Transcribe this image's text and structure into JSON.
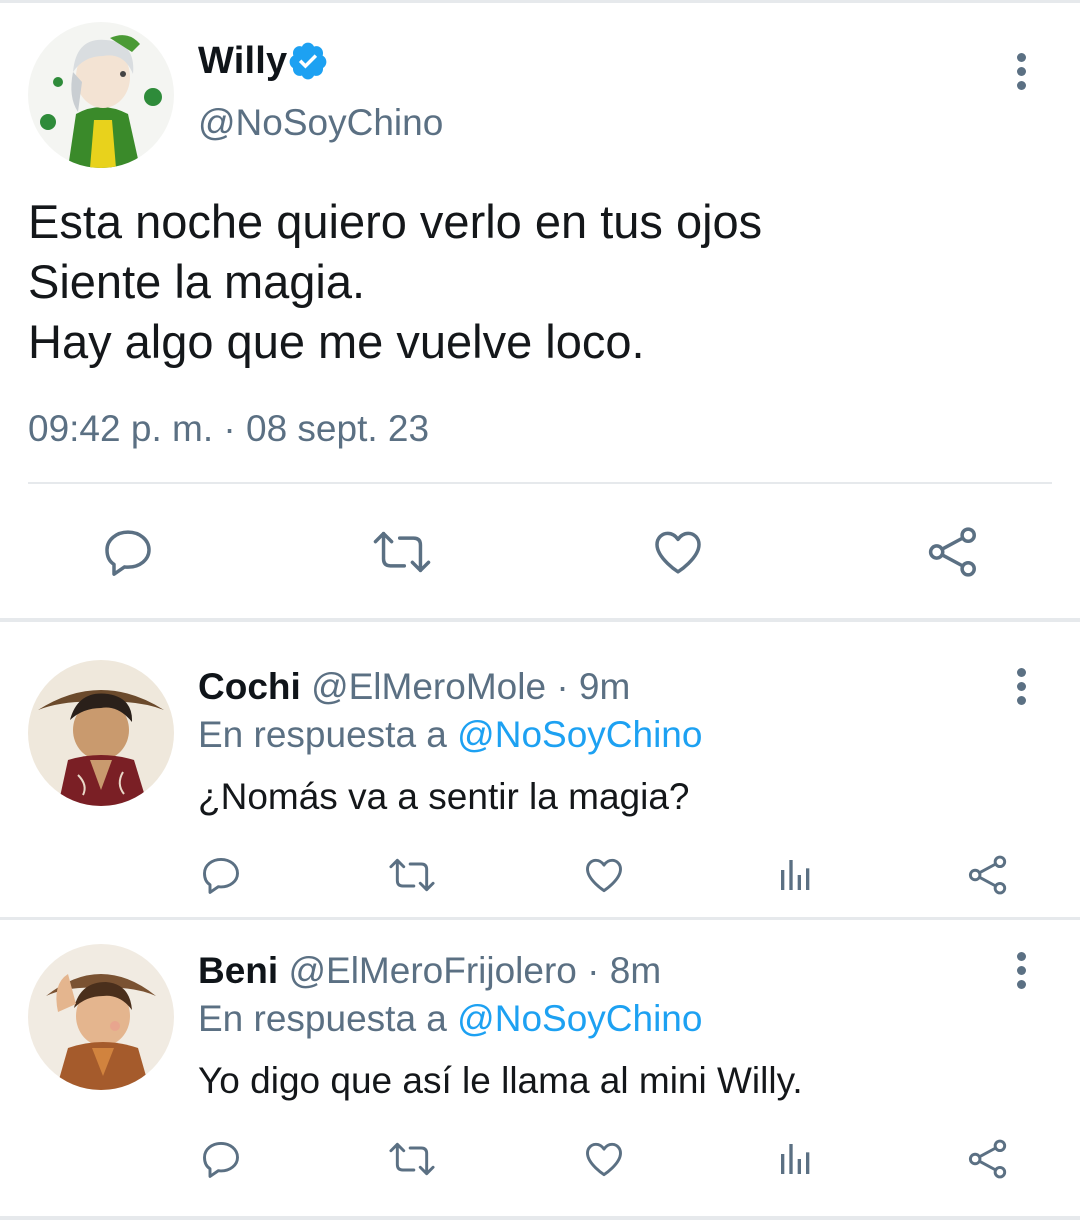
{
  "main_tweet": {
    "name": "Willy",
    "handle": "@NoSoyChino",
    "lines": [
      "Esta noche quiero verlo en tus ojos",
      "Siente la magia.",
      "Hay algo que me vuelve loco."
    ],
    "timestamp": "09:42 p. m. · 08 sept. 23",
    "actions": [
      "reply-icon",
      "retweet-icon",
      "like-icon",
      "share-icon"
    ]
  },
  "replies": [
    {
      "name": "Cochi",
      "handle": "@ElMeroMole",
      "time": "· 9m",
      "reply_prefix": "En respuesta a",
      "reply_to": "@NoSoyChino",
      "text": "¿Nomás va a sentir la magia?"
    },
    {
      "name": "Beni",
      "handle": "@ElMeroFrijolero",
      "time": "· 8m",
      "reply_prefix": "En respuesta a",
      "reply_to": "@NoSoyChino",
      "text": "Yo digo que así le llama al mini Willy."
    }
  ],
  "colors": {
    "accent": "#1da1f2",
    "secondary_text": "#5b7083",
    "icon": "#5b7083",
    "divider": "#e6e9ec"
  }
}
